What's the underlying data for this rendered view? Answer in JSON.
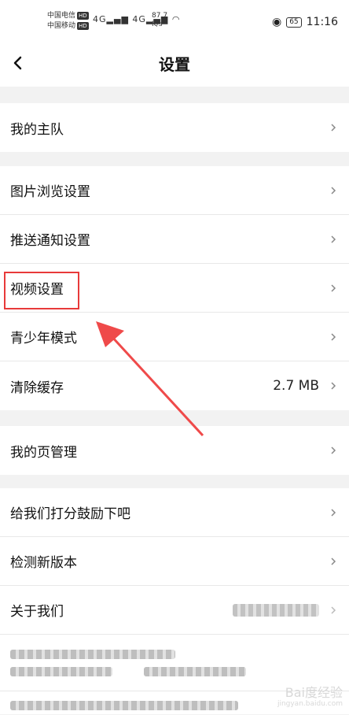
{
  "status": {
    "carrier1": "中国电信",
    "carrier2": "中国移动",
    "hd": "HD",
    "net": "4G",
    "speed_value": "87.7",
    "speed_unit": "K/s",
    "battery": "65",
    "time": "11:16"
  },
  "header": {
    "title": "设置"
  },
  "group1": {
    "my_team": "我的主队"
  },
  "group2": {
    "image_browse": "图片浏览设置",
    "push": "推送通知设置",
    "video": "视频设置",
    "youth": "青少年模式",
    "cache": "清除缓存",
    "cache_size": "2.7 MB"
  },
  "group3": {
    "page_manage": "我的页管理"
  },
  "group4": {
    "rate": "给我们打分鼓励下吧",
    "check_update": "检测新版本",
    "about": "关于我们"
  },
  "watermark": {
    "brand": "Bai度经验",
    "url": "jingyan.baidu.com"
  },
  "colors": {
    "highlight": "#e83a3a",
    "background": "#f2f2f2",
    "row": "#ffffff"
  }
}
